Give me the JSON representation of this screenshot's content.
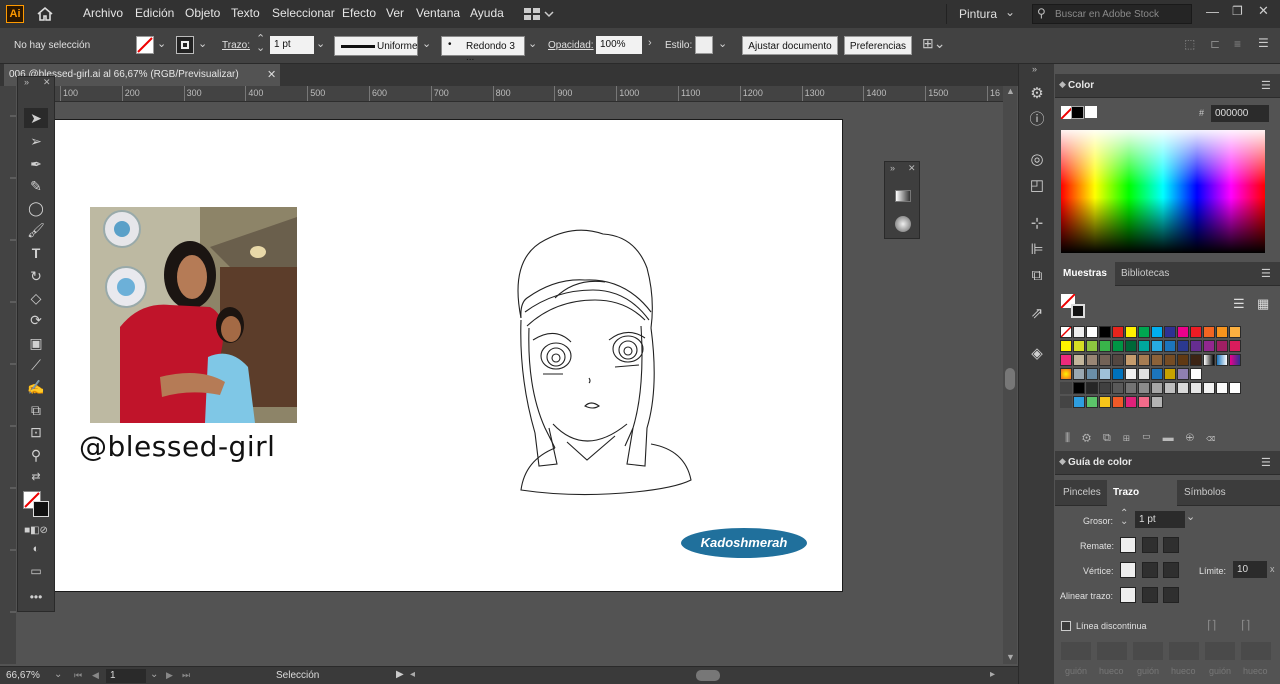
{
  "app": {
    "logo": "Ai"
  },
  "menu": [
    "Archivo",
    "Edición",
    "Objeto",
    "Texto",
    "Seleccionar",
    "Efecto",
    "Ver",
    "Ventana",
    "Ayuda"
  ],
  "topright": {
    "workspace": "Pintura",
    "search_placeholder": "Buscar en Adobe Stock"
  },
  "control": {
    "selection": "No hay selección",
    "stroke_label": "Trazo:",
    "stroke_value": "1 pt",
    "profile": "Uniforme",
    "brush": "Redondo 3 ...",
    "opacity_label": "Opacidad:",
    "opacity_value": "100%",
    "style_label": "Estilo:",
    "adjust_doc": "Ajustar documento",
    "prefs": "Preferencias"
  },
  "document": {
    "tab_title": "006 @blessed-girl.ai al 66,67% (RGB/Previsualizar)"
  },
  "ruler_labels": [
    "100",
    "200",
    "300",
    "400",
    "500",
    "600",
    "700",
    "800",
    "900",
    "1000",
    "1100",
    "1200",
    "1300",
    "1400",
    "1500",
    "16"
  ],
  "artboard": {
    "handle_text": "@blessed-girl",
    "badge_text": "Kadoshmerah"
  },
  "status": {
    "zoom": "66,67%",
    "page": "1",
    "tool": "Selección"
  },
  "color_panel": {
    "title": "Color",
    "hex": "000000"
  },
  "swatches_panel": {
    "tab_active": "Muestras",
    "tab_other": "Bibliotecas"
  },
  "color_guide": {
    "title": "Guía de color"
  },
  "stroke_panel": {
    "tab_brushes": "Pinceles",
    "tab_stroke": "Trazo",
    "tab_symbols": "Símbolos",
    "weight_label": "Grosor:",
    "weight_value": "1 pt",
    "cap_label": "Remate:",
    "corner_label": "Vértice:",
    "limit_label": "Límite:",
    "limit_value": "10",
    "align_label": "Alinear trazo:",
    "dashed_label": "Línea discontinua",
    "dash_labels": [
      "guión",
      "hueco",
      "guión",
      "hueco",
      "guión",
      "hueco"
    ]
  },
  "colors": {
    "accent": "#ff9a00",
    "badge": "#20709c",
    "panel_bg": "#535353",
    "bar_bg": "#323232"
  }
}
